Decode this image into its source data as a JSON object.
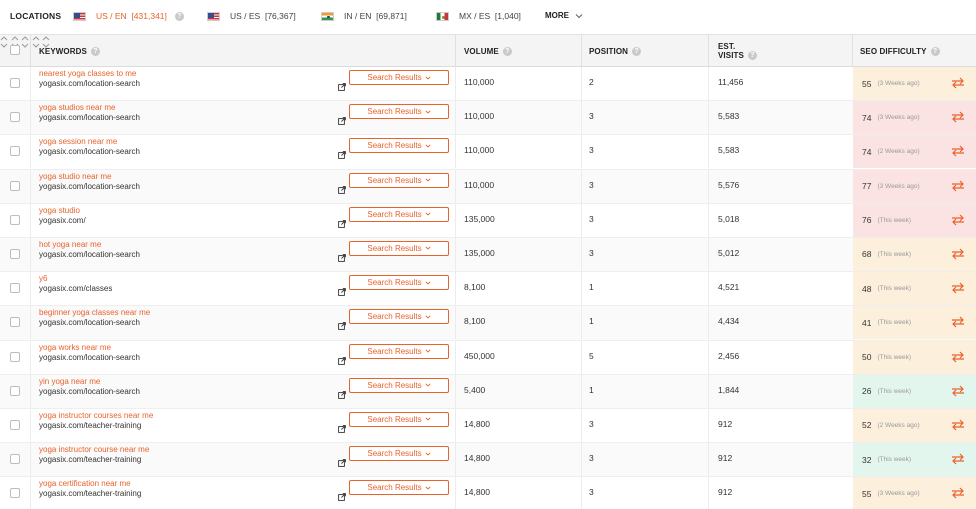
{
  "locations": {
    "label": "LOCATIONS",
    "items": [
      {
        "flag": "us",
        "text": "US / EN",
        "count": "[431,341]",
        "active": true
      },
      {
        "flag": "us",
        "text": "US / ES",
        "count": "[76,367]",
        "active": false
      },
      {
        "flag": "in",
        "text": "IN / EN",
        "count": "[69,871]",
        "active": false
      },
      {
        "flag": "mx",
        "text": "MX / ES",
        "count": "[1,040]",
        "active": false
      }
    ],
    "more_label": "MORE",
    "info_icon": "?"
  },
  "table": {
    "headers": {
      "keywords": "KEYWORDS",
      "volume": "VOLUME",
      "position": "POSITION",
      "est_visits_line1": "EST.",
      "est_visits_line2": "VISITS",
      "seo_difficulty": "SEO DIFFICULTY"
    },
    "search_results_label": "Search Results",
    "colors": {
      "accent": "#e8622c",
      "hard": "#fbe3e3",
      "medium": "#fcefdc",
      "easy": "#e3f6ee"
    },
    "rows": [
      {
        "keyword": "nearest yoga classes to me",
        "url": "yogasix.com/location-search",
        "volume": "110,000",
        "position": "2",
        "visits": "11,456",
        "seo": "55",
        "when": "(3 Weeks ago)",
        "level": "medium"
      },
      {
        "keyword": "yoga studios near me",
        "url": "yogasix.com/location-search",
        "volume": "110,000",
        "position": "3",
        "visits": "5,583",
        "seo": "74",
        "when": "(3 Weeks ago)",
        "level": "hard"
      },
      {
        "keyword": "yoga session near me",
        "url": "yogasix.com/location-search",
        "volume": "110,000",
        "position": "3",
        "visits": "5,583",
        "seo": "74",
        "when": "(2 Weeks ago)",
        "level": "hard"
      },
      {
        "keyword": "yoga studio near me",
        "url": "yogasix.com/location-search",
        "volume": "110,000",
        "position": "3",
        "visits": "5,576",
        "seo": "77",
        "when": "(3 Weeks ago)",
        "level": "hard"
      },
      {
        "keyword": "yoga studio",
        "url": "yogasix.com/",
        "volume": "135,000",
        "position": "3",
        "visits": "5,018",
        "seo": "76",
        "when": "(This week)",
        "level": "hard"
      },
      {
        "keyword": "hot yoga near me",
        "url": "yogasix.com/location-search",
        "volume": "135,000",
        "position": "3",
        "visits": "5,012",
        "seo": "68",
        "when": "(This week)",
        "level": "medium"
      },
      {
        "keyword": "y6",
        "url": "yogasix.com/classes",
        "volume": "8,100",
        "position": "1",
        "visits": "4,521",
        "seo": "48",
        "when": "(This week)",
        "level": "medium"
      },
      {
        "keyword": "beginner yoga classes near me",
        "url": "yogasix.com/location-search",
        "volume": "8,100",
        "position": "1",
        "visits": "4,434",
        "seo": "41",
        "when": "(This week)",
        "level": "medium"
      },
      {
        "keyword": "yoga works near me",
        "url": "yogasix.com/location-search",
        "volume": "450,000",
        "position": "5",
        "visits": "2,456",
        "seo": "50",
        "when": "(This week)",
        "level": "medium"
      },
      {
        "keyword": "yin yoga near me",
        "url": "yogasix.com/location-search",
        "volume": "5,400",
        "position": "1",
        "visits": "1,844",
        "seo": "26",
        "when": "(This week)",
        "level": "easy"
      },
      {
        "keyword": "yoga instructor courses near me",
        "url": "yogasix.com/teacher-training",
        "volume": "14,800",
        "position": "3",
        "visits": "912",
        "seo": "52",
        "when": "(2 Weeks ago)",
        "level": "medium"
      },
      {
        "keyword": "yoga instructor course near me",
        "url": "yogasix.com/teacher-training",
        "volume": "14,800",
        "position": "3",
        "visits": "912",
        "seo": "32",
        "when": "(This week)",
        "level": "easy"
      },
      {
        "keyword": "yoga certification near me",
        "url": "yogasix.com/teacher-training",
        "volume": "14,800",
        "position": "3",
        "visits": "912",
        "seo": "55",
        "when": "(3 Weeks ago)",
        "level": "medium"
      }
    ]
  }
}
